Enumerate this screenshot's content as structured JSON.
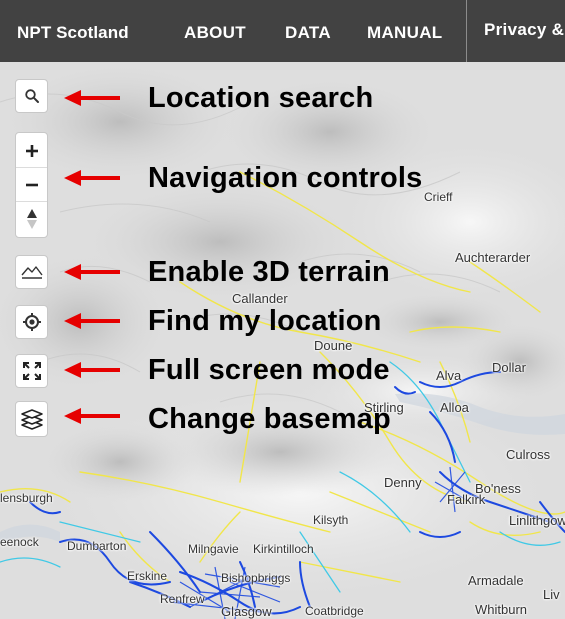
{
  "header": {
    "brand": "NPT Scotland",
    "nav": [
      "ABOUT",
      "DATA",
      "MANUAL"
    ],
    "privacy": "Privacy &"
  },
  "controls": [
    {
      "name": "search",
      "icon": "search-icon"
    },
    {
      "name": "zoom-in",
      "icon": "plus-icon"
    },
    {
      "name": "zoom-out",
      "icon": "minus-icon"
    },
    {
      "name": "compass",
      "icon": "compass-icon"
    },
    {
      "name": "terrain",
      "icon": "terrain-icon"
    },
    {
      "name": "geolocate",
      "icon": "locate-icon"
    },
    {
      "name": "fullscreen",
      "icon": "fullscreen-icon"
    },
    {
      "name": "basemap",
      "icon": "layers-icon"
    }
  ],
  "annotations": {
    "search": "Location search",
    "navigation": "Navigation controls",
    "terrain": "Enable 3D terrain",
    "locate": "Find my location",
    "fullscreen": "Full screen mode",
    "basemap": "Change basemap"
  },
  "places": {
    "crieff": "Crieff",
    "auchterarder": "Auchterarder",
    "callander": "Callander",
    "doune": "Doune",
    "dollar": "Dollar",
    "alva": "Alva",
    "stirling": "Stirling",
    "alloa": "Alloa",
    "culross": "Culross",
    "denny": "Denny",
    "falkirk": "Falkirk",
    "boness": "Bo'ness",
    "linlithgow": "Linlithgow",
    "helensburgh": "lensburgh",
    "kilsyth": "Kilsyth",
    "greenock": "eenock",
    "dumbarton": "Dumbarton",
    "milngavie": "Milngavie",
    "kirkintilloch": "Kirkintilloch",
    "erskine": "Erskine",
    "bishopbriggs": "Bishopbriggs",
    "renfrew": "Renfrew",
    "glasgow": "Glasgow",
    "coatbridge": "Coatbridge",
    "armadale": "Armadale",
    "whitburn": "Whitburn",
    "livingston": "Liv"
  },
  "colors": {
    "nav_bg": "#424242",
    "arrow": "#e60000",
    "network_blue": "#1f4fe0",
    "network_yellow": "#f5ea3a",
    "network_cyan": "#33c8e8"
  }
}
